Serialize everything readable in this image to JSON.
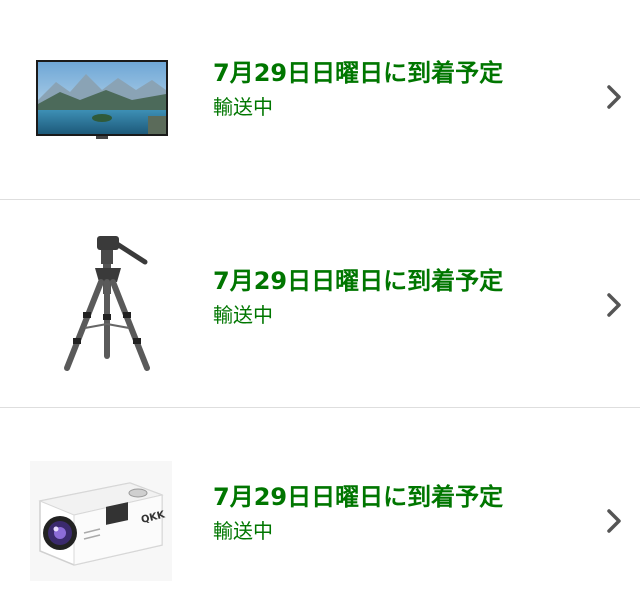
{
  "orders": [
    {
      "delivery": "7月29日日曜日に到着予定",
      "status": "輸送中",
      "product_icon": "tv-icon"
    },
    {
      "delivery": "7月29日日曜日に到着予定",
      "status": "輸送中",
      "product_icon": "tripod-icon"
    },
    {
      "delivery": "7月29日日曜日に到着予定",
      "status": "輸送中",
      "product_icon": "projector-icon",
      "brand_mark": "QKK"
    }
  ],
  "colors": {
    "status_green": "#007600",
    "divider": "#dedede",
    "chevron": "#555555"
  }
}
